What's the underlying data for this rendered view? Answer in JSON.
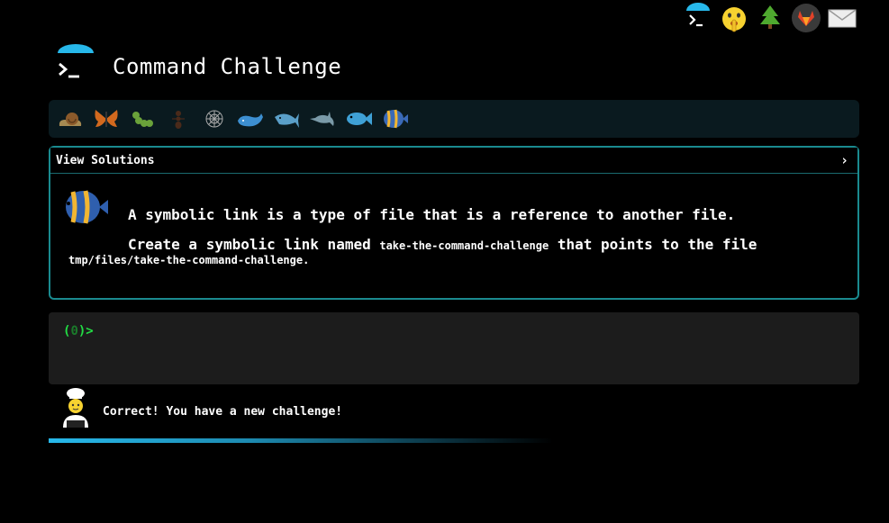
{
  "header": {
    "title": "Command Challenge",
    "top_icons": [
      "terminal-logo-icon",
      "shush-emoji-icon",
      "evergreen-tree-icon",
      "gitlab-icon",
      "mail-icon"
    ]
  },
  "levels": {
    "icons": [
      "snail-icon",
      "butterfly-icon",
      "caterpillar-icon",
      "ant-icon",
      "spider-web-icon",
      "whale-icon",
      "shark-icon",
      "dolphin-icon",
      "fish-icon",
      "tropical-fish-icon"
    ]
  },
  "challenge": {
    "solutions_label": "View Solutions",
    "solutions_caret": "›",
    "description_line1": "A symbolic link is a type of file that is a reference to another file.",
    "description_part1": "Create a symbolic link named ",
    "link_name": "take-the-command-challenge",
    "description_part2": " that points to the file",
    "target_path": "tmp/files/take-the-command-challenge."
  },
  "terminal": {
    "prompt_open": "(",
    "prompt_count": "0",
    "prompt_close": ")>",
    "input_value": ""
  },
  "feedback": {
    "message": "Correct! You have a new challenge!"
  },
  "colors": {
    "accent": "#27b8ea",
    "border": "#1a8a8f",
    "prompt": "#22dd44",
    "background": "#000000"
  }
}
